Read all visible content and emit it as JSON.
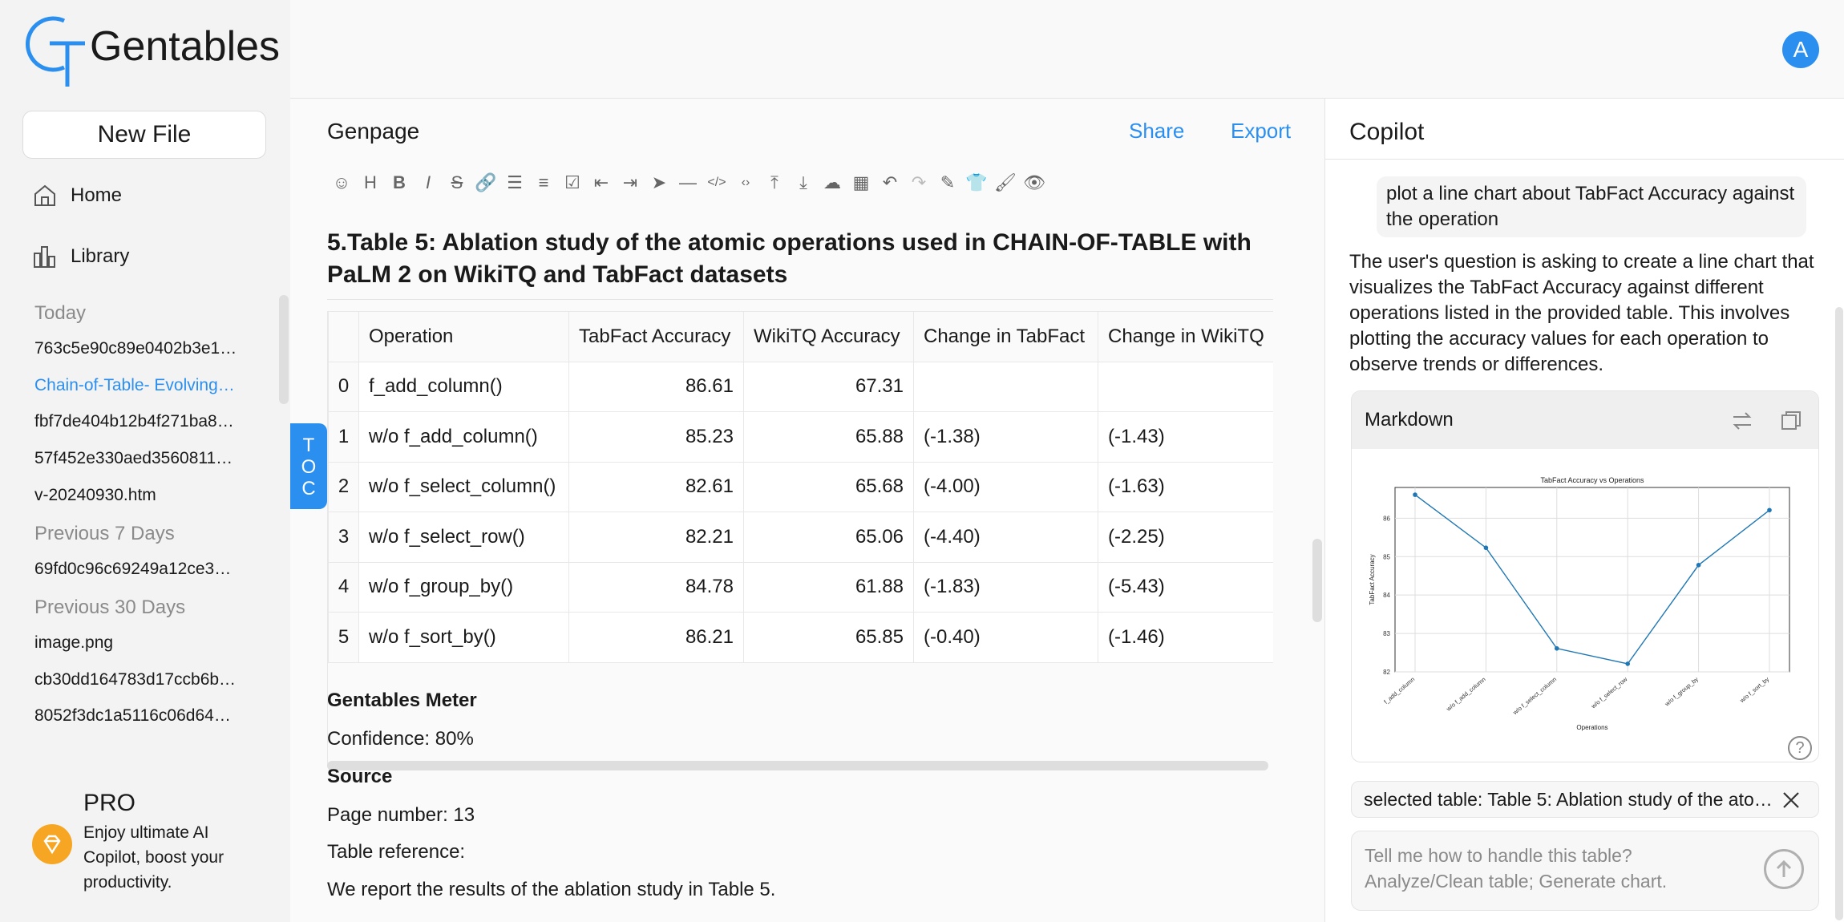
{
  "brand": {
    "name": "Gentables",
    "accent": "#2b8ff0"
  },
  "sidebar": {
    "new_file": "New File",
    "nav": [
      {
        "label": "Home",
        "icon": "home-icon"
      },
      {
        "label": "Library",
        "icon": "library-icon"
      }
    ],
    "sections": [
      {
        "label": "Today",
        "items": [
          "763c5e90c89e0402b3e1…",
          "Chain-of-Table- Evolving…",
          "fbf7de404b12b4f271ba8…",
          "57f452e330aed3560811…",
          "v-20240930.htm"
        ]
      },
      {
        "label": "Previous 7 Days",
        "items": [
          "69fd0c96c69249a12ce3…"
        ]
      },
      {
        "label": "Previous 30 Days",
        "items": [
          "image.png",
          "cb30dd164783d17ccb6b…",
          "8052f3dc1a5116c06d64…"
        ]
      }
    ],
    "pro": {
      "title": "PRO",
      "desc": "Enjoy ultimate AI Copilot, boost your productivity."
    }
  },
  "user": {
    "avatar_letter": "A"
  },
  "genpage": {
    "title": "Genpage",
    "share": "Share",
    "export": "Export",
    "toc": "TOC",
    "toolbar": [
      "emoji-icon",
      "heading-icon",
      "bold-icon",
      "italic-icon",
      "strike-icon",
      "link-icon",
      "bullet-list-icon",
      "ordered-list-icon",
      "checklist-icon",
      "outdent-icon",
      "indent-icon",
      "send-icon",
      "divider-icon",
      "code-icon",
      "inline-code-icon",
      "upload-top-icon",
      "download-icon",
      "cloud-upload-icon",
      "table-icon",
      "undo-icon",
      "redo-icon",
      "edit-icon",
      "theme-icon",
      "paint-icon",
      "preview-icon"
    ],
    "heading": "5.Table 5: Ablation study of the atomic operations used in CHAIN-OF-TABLE with PaLM 2 on WikiTQ and TabFact datasets",
    "table": {
      "columns": [
        "",
        "Operation",
        "TabFact Accuracy",
        "WikiTQ Accuracy",
        "Change in TabFact",
        "Change in WikiTQ"
      ],
      "rows": [
        [
          "0",
          "f_add_column()",
          "86.61",
          "67.31",
          "",
          ""
        ],
        [
          "1",
          "w/o f_add_column()",
          "85.23",
          "65.88",
          "(-1.38)",
          "(-1.43)"
        ],
        [
          "2",
          "w/o f_select_column()",
          "82.61",
          "65.68",
          "(-4.00)",
          "(-1.63)"
        ],
        [
          "3",
          "w/o f_select_row()",
          "82.21",
          "65.06",
          "(-4.40)",
          "(-2.25)"
        ],
        [
          "4",
          "w/o f_group_by()",
          "84.78",
          "61.88",
          "(-1.83)",
          "(-5.43)"
        ],
        [
          "5",
          "w/o f_sort_by()",
          "86.21",
          "65.85",
          "(-0.40)",
          "(-1.46)"
        ]
      ]
    },
    "meter_title": "Gentables Meter",
    "confidence": "Confidence: 80%",
    "source_title": "Source",
    "page_number": "Page number: 13",
    "table_reference": "Table reference:",
    "report": "We report the results of the ablation study in Table 5."
  },
  "copilot": {
    "title": "Copilot",
    "user_message": "plot a line chart about TabFact Accuracy against the operation",
    "assistant_message": "The user's question is asking to create a line chart that visualizes the TabFact Accuracy against different operations listed in the provided table. This involves plotting the accuracy values for each operation to observe trends or differences.",
    "card_title": "Markdown",
    "help": "?",
    "selected_table": "selected table: Table 5: Ablation study of the atomic operations used in CHAIN-OF-TABLE with PaLM 2 on WikiTQ and TabFact datasets",
    "input_placeholder": "Tell me how to handle this table?\nAnalyze/Clean table; Generate chart."
  },
  "chart_data": {
    "type": "line",
    "title": "TabFact Accuracy vs Operations",
    "xlabel": "Operations",
    "ylabel": "TabFact Accuracy",
    "categories": [
      "f_add_column",
      "w/o f_add_column",
      "w/o f_select_column",
      "w/o f_select_row",
      "w/o f_group_by",
      "w/o f_sort_by"
    ],
    "values": [
      86.61,
      85.23,
      82.61,
      82.21,
      84.78,
      86.21
    ],
    "y_ticks": [
      82,
      83,
      84,
      85,
      86
    ],
    "ylim": [
      82,
      86.8
    ],
    "grid": true,
    "color": "#1f77b4"
  }
}
